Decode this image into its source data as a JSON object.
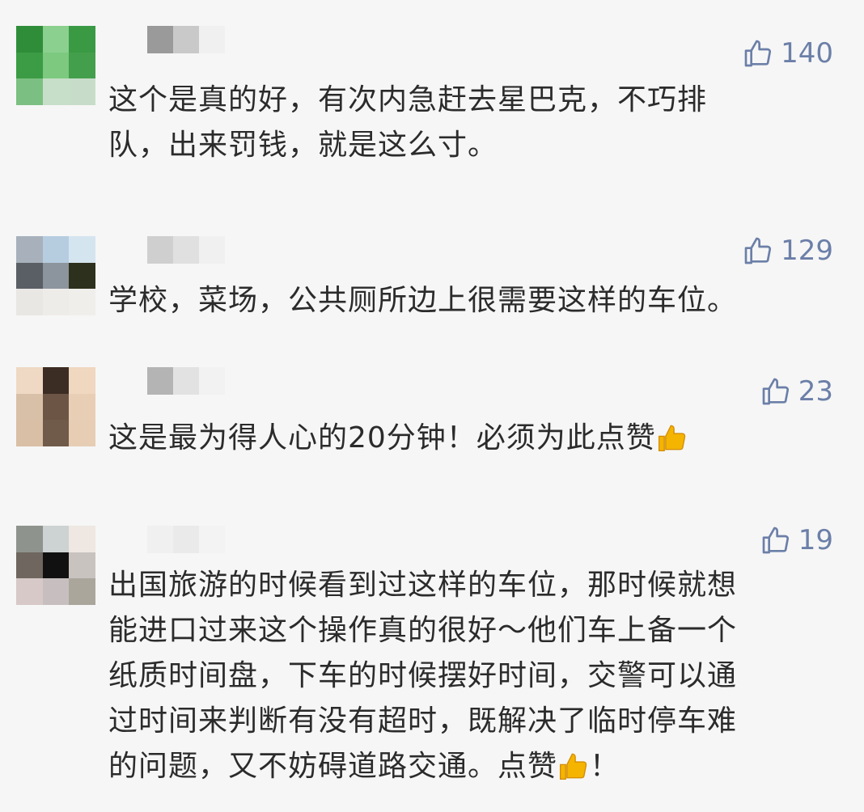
{
  "comments": [
    {
      "likes": "140",
      "text": "这个是真的好，有次内急赶去星巴克，不巧排\n队，出来罚钱，就是这么寸。",
      "avatar_colors": [
        "#2f8d3a",
        "#8bd08e",
        "#3a9a44",
        "#3b9c45",
        "#7cc97f",
        "#449f4c",
        "#7cbf82",
        "#c7dfc8",
        "#c8ddc9"
      ],
      "name_colors": [
        "#9a9a9a",
        "#c9c9c9",
        "#f0f0f0"
      ]
    },
    {
      "likes": "129",
      "text": "学校，菜场，公共厕所边上很需要这样的车位。",
      "avatar_colors": [
        "#a8b1bb",
        "#b6cde0",
        "#d5e5ef",
        "#5a5f66",
        "#8c959d",
        "#2d301c",
        "#e9e7e4",
        "#eeece9",
        "#f0eeeb"
      ],
      "name_colors": [
        "#cfcfcf",
        "#e0e0e0",
        "#f0f0f0"
      ]
    },
    {
      "likes": "23",
      "text": "这是最为得人心的20分钟！必须为此点赞",
      "avatar_colors": [
        "#efd9c4",
        "#3b2c24",
        "#efd7c0",
        "#d8c0a8",
        "#6d5546",
        "#e8ceb5",
        "#d9bfa5",
        "#705a4a",
        "#e6cdb3"
      ],
      "name_colors": [
        "#b4b4b4",
        "#e2e2e2",
        "#f2f2f2"
      ]
    },
    {
      "likes": "19",
      "text": "出国旅游的时候看到过这样的车位，那时候就想\n能进口过来这个操作真的很好～他们车上备一个\n纸质时间盘，下车的时候摆好时间，交警可以通\n过时间来判断有没有超时，既解决了临时停车难\n的问题，又不妨碍道路交通。点赞",
      "text_tail": "！",
      "avatar_colors": [
        "#8f938d",
        "#cdd2d2",
        "#eee7e2",
        "#6e665f",
        "#111111",
        "#c9c3c0",
        "#d7c9c8",
        "#c7bfbf",
        "#aaa69c"
      ],
      "name_colors": [
        "#f0f0f0",
        "#eaeaea",
        "#f3f3f3"
      ]
    }
  ],
  "like_color": "#6b7fa8",
  "thumb_emoji_color": "#f4b400"
}
